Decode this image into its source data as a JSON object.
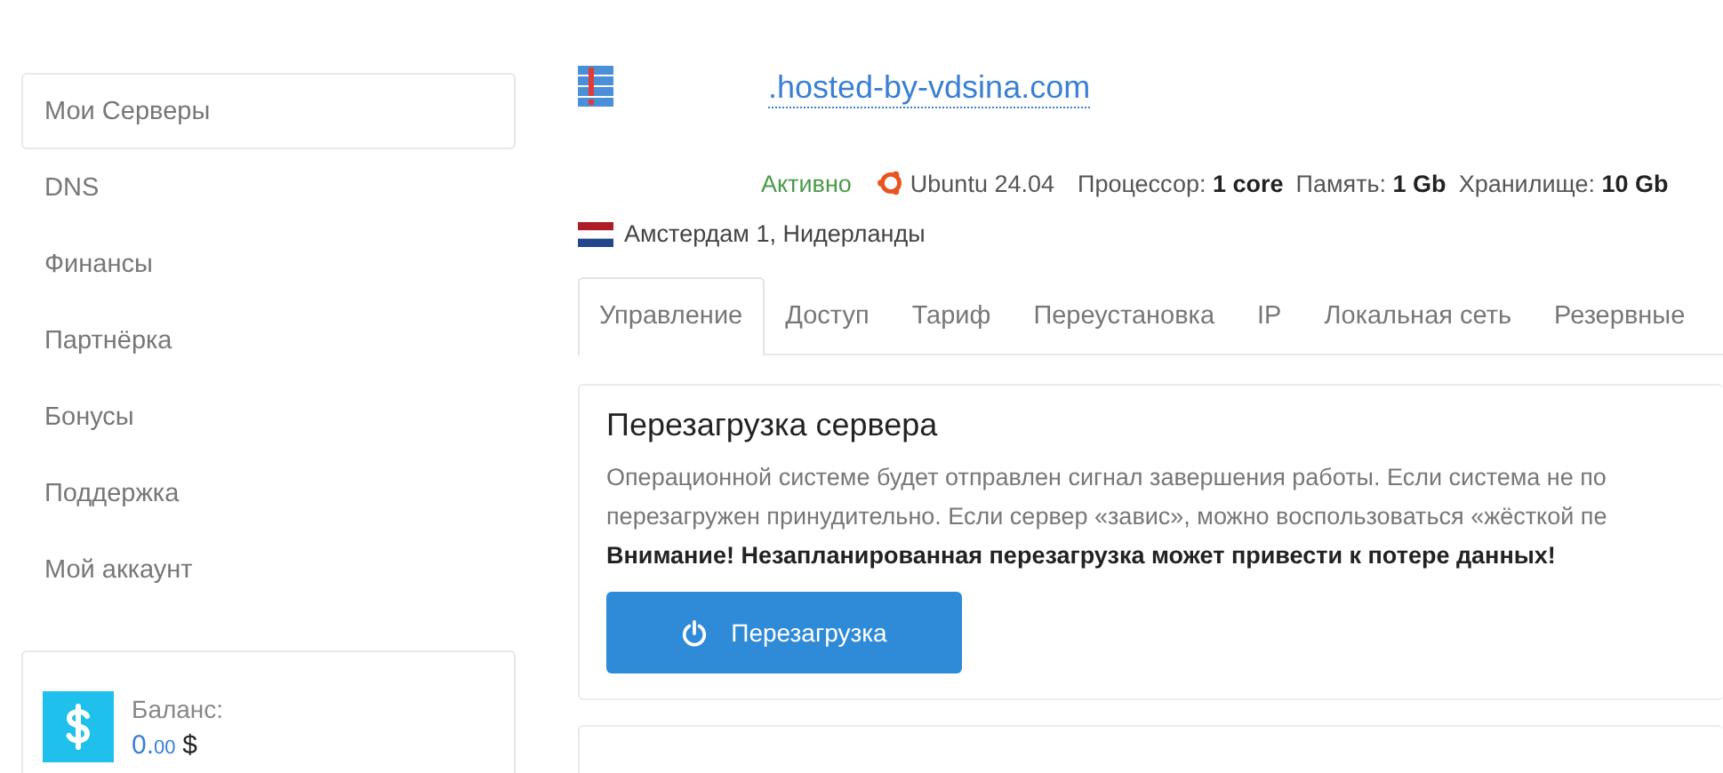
{
  "sidebar": {
    "items": [
      {
        "label": "Мои Серверы",
        "selected": true
      },
      {
        "label": "DNS",
        "selected": false
      },
      {
        "label": "Финансы",
        "selected": false
      },
      {
        "label": "Партнёрка",
        "selected": false
      },
      {
        "label": "Бонусы",
        "selected": false
      },
      {
        "label": "Поддержка",
        "selected": false
      },
      {
        "label": "Мой аккаунт",
        "selected": false
      }
    ],
    "balance": {
      "label": "Баланс:",
      "amount": "0.",
      "cents": "00",
      "currency": "$"
    }
  },
  "server": {
    "hostname": ".hosted-by-vdsina.com",
    "status": "Активно",
    "os": "Ubuntu 24.04",
    "specs": [
      {
        "label": "Процессор:",
        "value": "1 core"
      },
      {
        "label": "Память:",
        "value": "1 Gb"
      },
      {
        "label": "Хранилище:",
        "value": "10 Gb"
      }
    ],
    "location": "Амстердам 1, Нидерланды"
  },
  "tabs": [
    {
      "label": "Управление",
      "selected": true
    },
    {
      "label": "Доступ",
      "selected": false
    },
    {
      "label": "Тариф",
      "selected": false
    },
    {
      "label": "Переустановка",
      "selected": false
    },
    {
      "label": "IP",
      "selected": false
    },
    {
      "label": "Локальная сеть",
      "selected": false
    },
    {
      "label": "Резервные",
      "selected": false
    }
  ],
  "reboot_panel": {
    "title": "Перезагрузка сервера",
    "description_lines": [
      "Операционной системе будет отправлен сигнал завершения работы. Если система не по",
      "перезагружен принудительно. Если сервер «завис», можно воспользоваться «жёсткой пе"
    ],
    "warning": "Внимание! Незапланированная перезагрузка может привести к потере данных!",
    "button": "Перезагрузка"
  }
}
